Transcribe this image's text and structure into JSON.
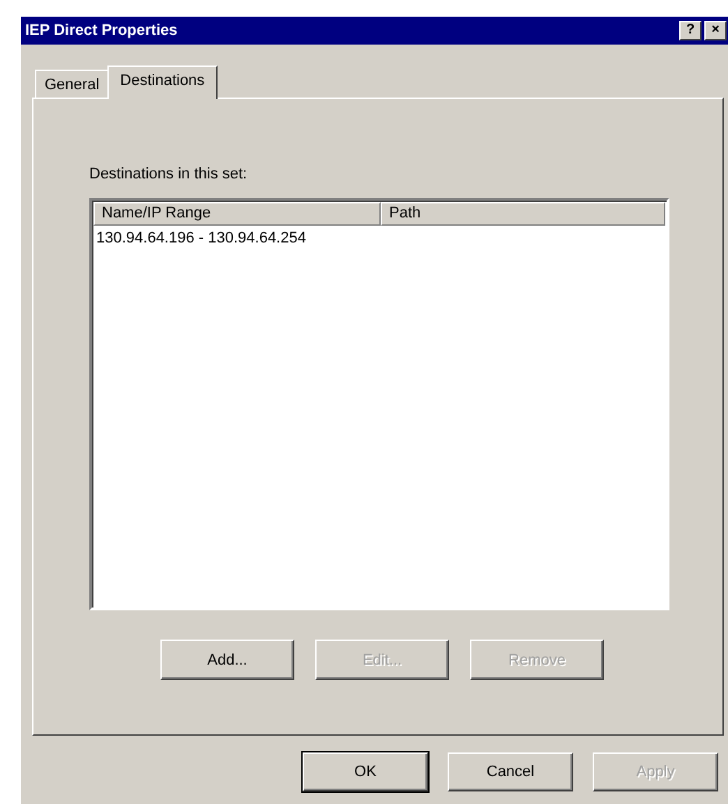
{
  "window": {
    "title": "IEP Direct Properties",
    "help_button": "?",
    "close_button": "×"
  },
  "tabs": [
    {
      "label": "General",
      "selected": false
    },
    {
      "label": "Destinations",
      "selected": true
    }
  ],
  "destinations": {
    "label": "Destinations in this set:",
    "columns": [
      "Name/IP Range",
      "Path"
    ],
    "rows": [
      {
        "cells": [
          "130.94.64.196 - 130.94.64.254",
          ""
        ],
        "selected": false
      }
    ]
  },
  "list_buttons": [
    {
      "label": "Add...",
      "disabled": false
    },
    {
      "label": "Edit...",
      "disabled": true
    },
    {
      "label": "Remove",
      "disabled": true
    }
  ],
  "dialog_buttons": [
    {
      "label": "OK",
      "disabled": false,
      "default": true
    },
    {
      "label": "Cancel",
      "disabled": false,
      "default": false
    },
    {
      "label": "Apply",
      "disabled": true,
      "default": false
    }
  ]
}
